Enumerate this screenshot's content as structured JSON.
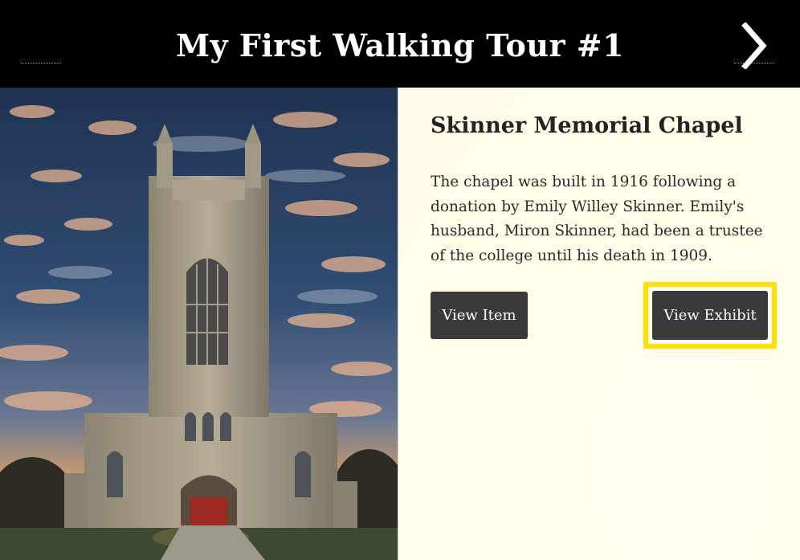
{
  "header": {
    "title": "My First Walking Tour #1",
    "next_icon": "chevron-right-icon"
  },
  "photo": {
    "subject": "chapel-photo"
  },
  "stop": {
    "title": "Skinner Memorial Chapel",
    "description": "The chapel was built in 1916 following a donation by Emily Willey Skinner. Emily's husband, Miron Skinner, had been a trustee of the college until his death in 1909.",
    "view_item_label": "View Item",
    "view_exhibit_label": "View Exhibit"
  },
  "colors": {
    "header_bg": "#000000",
    "panel_bg": "#fffbe8",
    "button_bg": "#3a3a3a",
    "focus_highlight": "#ffe100"
  }
}
